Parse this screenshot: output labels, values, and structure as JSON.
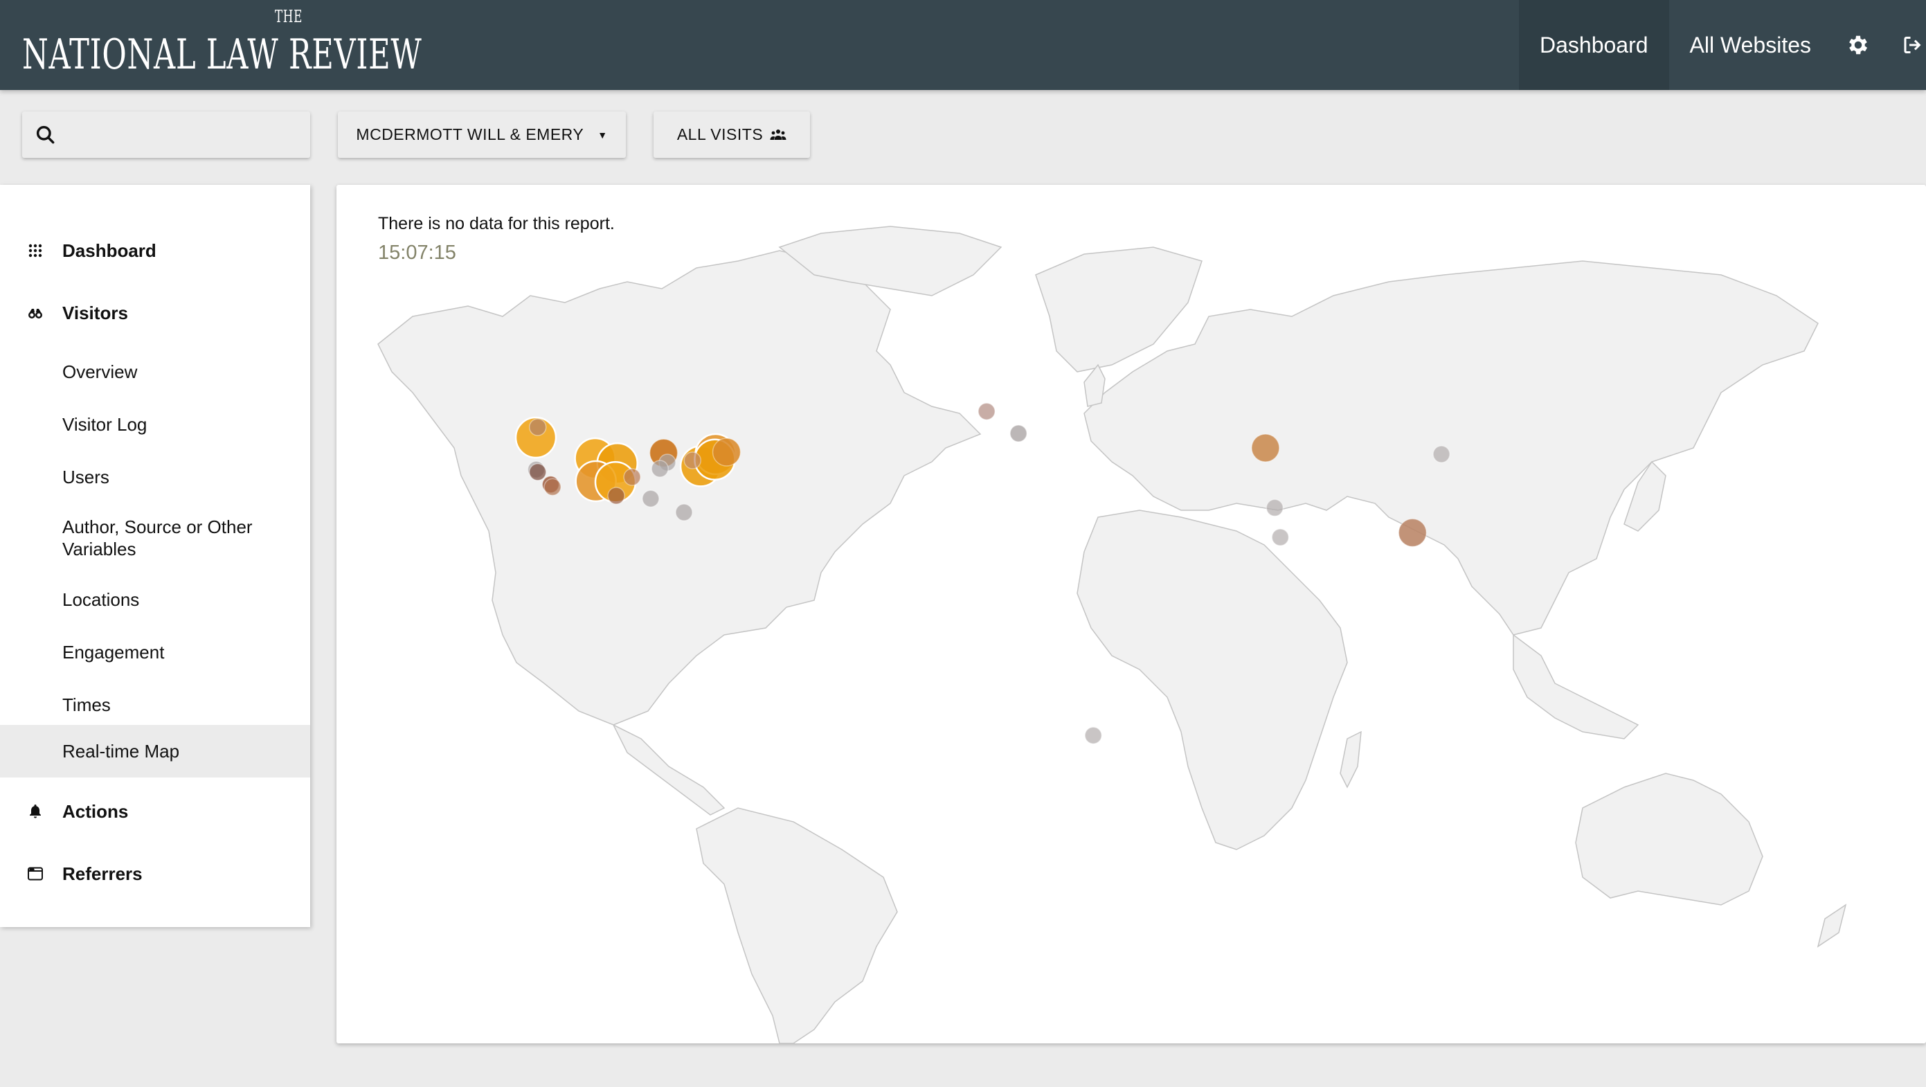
{
  "header": {
    "logo_top": "THE",
    "logo_name": "NATIONAL LAW REVIEW",
    "nav": [
      {
        "label": "Dashboard",
        "active": true
      },
      {
        "label": "All Websites",
        "active": false
      }
    ],
    "icons": [
      "gear-icon",
      "sign-out-icon"
    ]
  },
  "toolbar": {
    "search_value": "",
    "site_selector_label": "MCDERMOTT WILL & EMERY",
    "segment_label": "ALL VISITS"
  },
  "sidebar": {
    "items": [
      {
        "label": "Dashboard",
        "type": "section",
        "icon": "grid-icon"
      },
      {
        "label": "Visitors",
        "type": "section",
        "icon": "binoculars-icon"
      },
      {
        "label": "Overview",
        "type": "sub"
      },
      {
        "label": "Visitor Log",
        "type": "sub"
      },
      {
        "label": "Users",
        "type": "sub"
      },
      {
        "label": "Author, Source or Other Variables",
        "type": "sub"
      },
      {
        "label": "Locations",
        "type": "sub"
      },
      {
        "label": "Engagement",
        "type": "sub"
      },
      {
        "label": "Times",
        "type": "sub"
      },
      {
        "label": "Real-time Map",
        "type": "sub",
        "active": true
      },
      {
        "label": "Actions",
        "type": "section",
        "icon": "bell-icon"
      },
      {
        "label": "Referrers",
        "type": "section",
        "icon": "browser-window-icon"
      }
    ]
  },
  "main": {
    "no_data_message": "There is no data for this report.",
    "clock": "15:07:15"
  },
  "colors": {
    "header_bg": "#37474f",
    "header_active": "#2f3e45",
    "recent_visit": "#f0a416",
    "older_visit": "#8b4a2a",
    "oldest_visit": "#a9a4a4",
    "clock_text": "#838369"
  },
  "visitor_markers": [
    {
      "region": "Pacific Northwest US",
      "lon": -122.5,
      "lat": 45.5,
      "size": "large",
      "color": "#f0a416"
    },
    {
      "region": "Vancouver area",
      "lon": -122.0,
      "lat": 48.0,
      "size": "small",
      "color": "#b08067"
    },
    {
      "region": "San Francisco area",
      "lon": -122.4,
      "lat": 37.8,
      "size": "small",
      "color": "#a9a4a4"
    },
    {
      "region": "San Francisco area",
      "lon": -122.0,
      "lat": 37.2,
      "size": "small",
      "color": "#7b4a3c"
    },
    {
      "region": "Los Angeles area",
      "lon": -118.5,
      "lat": 34.2,
      "size": "small",
      "color": "#8b3b17"
    },
    {
      "region": "Los Angeles area",
      "lon": -118.0,
      "lat": 33.6,
      "size": "small",
      "color": "#b0724d"
    },
    {
      "region": "Denver area",
      "lon": -106.5,
      "lat": 40.5,
      "size": "large",
      "color": "#f0a416"
    },
    {
      "region": "Kansas area",
      "lon": -100.5,
      "lat": 39.3,
      "size": "large",
      "color": "#ec9d0a"
    },
    {
      "region": "New Mexico area",
      "lon": -106.3,
      "lat": 35.0,
      "size": "large",
      "color": "#e49429"
    },
    {
      "region": "Texas panhandle",
      "lon": -101.0,
      "lat": 34.8,
      "size": "large",
      "color": "#f0a416"
    },
    {
      "region": "Oklahoma area",
      "lon": -96.5,
      "lat": 36.0,
      "size": "small",
      "color": "#b97a55"
    },
    {
      "region": "Texas",
      "lon": -100.8,
      "lat": 31.5,
      "size": "small",
      "color": "#9a5a3c"
    },
    {
      "region": "Chicago area",
      "lon": -88.0,
      "lat": 41.8,
      "size": "medium",
      "color": "#c96f13"
    },
    {
      "region": "Indiana area",
      "lon": -87.0,
      "lat": 39.5,
      "size": "small",
      "color": "#a9a4a4"
    },
    {
      "region": "Missouri area",
      "lon": -89.0,
      "lat": 38.0,
      "size": "small",
      "color": "#a9a4a4"
    },
    {
      "region": "Louisiana area",
      "lon": -91.5,
      "lat": 30.8,
      "size": "small",
      "color": "#a9a4a4"
    },
    {
      "region": "Florida",
      "lon": -82.5,
      "lat": 27.5,
      "size": "small",
      "color": "#a9a4a4"
    },
    {
      "region": "Washington DC area",
      "lon": -78.0,
      "lat": 38.6,
      "size": "large",
      "color": "#ec9d0a"
    },
    {
      "region": "New York area",
      "lon": -74.0,
      "lat": 41.5,
      "size": "large",
      "color": "#e49429"
    },
    {
      "region": "New Jersey area",
      "lon": -74.2,
      "lat": 40.2,
      "size": "large",
      "color": "#ec9d0a"
    },
    {
      "region": "Boston area",
      "lon": -71.0,
      "lat": 42.0,
      "size": "medium",
      "color": "#d98a2a"
    },
    {
      "region": "Pennsylvania area",
      "lon": -80.2,
      "lat": 40.0,
      "size": "small",
      "color": "#c08a6a"
    },
    {
      "region": "United Kingdom",
      "lon": -0.8,
      "lat": 51.8,
      "size": "small",
      "color": "#b08a80"
    },
    {
      "region": "Switzerland",
      "lon": 7.8,
      "lat": 46.5,
      "size": "small",
      "color": "#a09898"
    },
    {
      "region": "Kazakhstan/Kyrgyzstan",
      "lon": 74.5,
      "lat": 43.0,
      "size": "medium",
      "color": "#c98a4e"
    },
    {
      "region": "Beijing",
      "lon": 122.0,
      "lat": 41.5,
      "size": "small",
      "color": "#b2adad"
    },
    {
      "region": "North India",
      "lon": 77.0,
      "lat": 28.6,
      "size": "small",
      "color": "#b2adad"
    },
    {
      "region": "Central India",
      "lon": 78.5,
      "lat": 21.5,
      "size": "small",
      "color": "#b2adad"
    },
    {
      "region": "Hong Kong / Shenzhen",
      "lon": 114.2,
      "lat": 22.6,
      "size": "medium",
      "color": "#b98465"
    },
    {
      "region": "Johannesburg",
      "lon": 28.0,
      "lat": -26.2,
      "size": "small",
      "color": "#b2adad"
    }
  ]
}
